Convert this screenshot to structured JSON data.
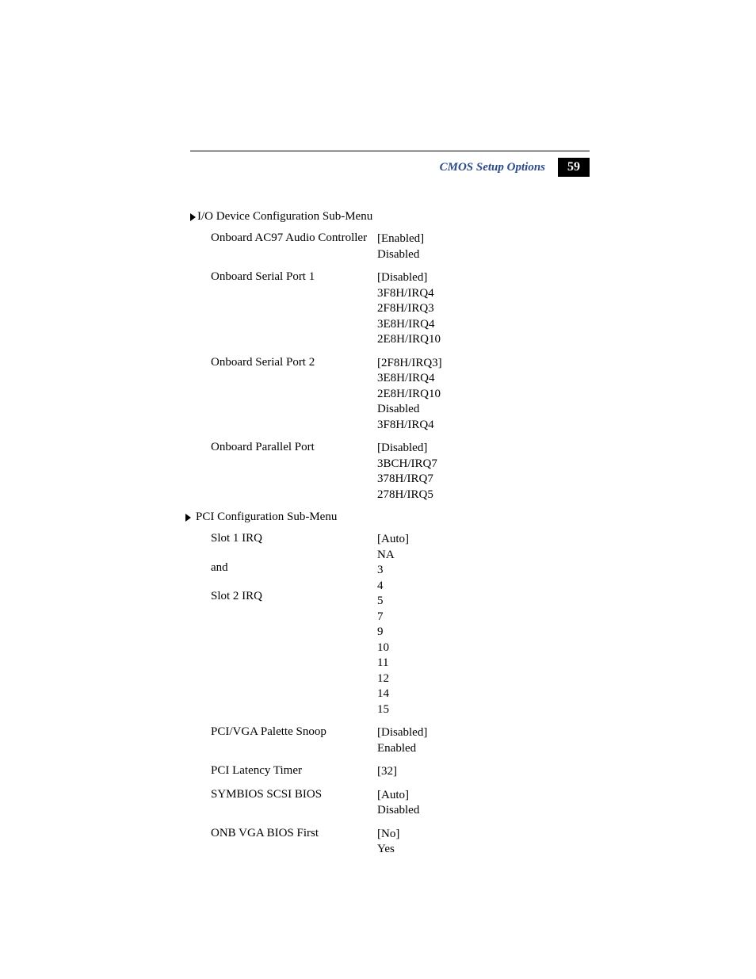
{
  "header": {
    "title": "CMOS Setup Options",
    "page_num": "59"
  },
  "sections": [
    {
      "title": "I/O Device Configuration Sub-Menu",
      "items": [
        {
          "label": "Onboard AC97 Audio Controller",
          "values": [
            "[Enabled]",
            "Disabled"
          ]
        },
        {
          "label": "Onboard Serial Port 1",
          "values": [
            "[Disabled]",
            "3F8H/IRQ4",
            "2F8H/IRQ3",
            "3E8H/IRQ4",
            "2E8H/IRQ10"
          ]
        },
        {
          "label": "Onboard Serial Port 2",
          "values": [
            "[2F8H/IRQ3]",
            "3E8H/IRQ4",
            "2E8H/IRQ10",
            "Disabled",
            "3F8H/IRQ4"
          ]
        },
        {
          "label": "Onboard Parallel Port",
          "values": [
            "[Disabled]",
            "3BCH/IRQ7",
            "378H/IRQ7",
            "278H/IRQ5"
          ]
        }
      ]
    },
    {
      "title": "PCI Configuration Sub-Menu",
      "items": [
        {
          "label_lines": [
            "Slot 1 IRQ",
            "",
            "and",
            "",
            "Slot 2 IRQ"
          ],
          "values": [
            "[Auto]",
            "NA",
            "3",
            "4",
            "5",
            "7",
            "9",
            "10",
            "11",
            "12",
            "14",
            "15"
          ]
        },
        {
          "label": "PCI/VGA Palette Snoop",
          "values": [
            "[Disabled]",
            "Enabled"
          ]
        },
        {
          "label": "PCI Latency Timer",
          "values": [
            "[32]"
          ]
        },
        {
          "label": "SYMBIOS SCSI BIOS",
          "values": [
            "[Auto]",
            "Disabled"
          ]
        },
        {
          "label": "ONB VGA BIOS First",
          "values": [
            "[No]",
            "Yes"
          ]
        }
      ]
    }
  ]
}
